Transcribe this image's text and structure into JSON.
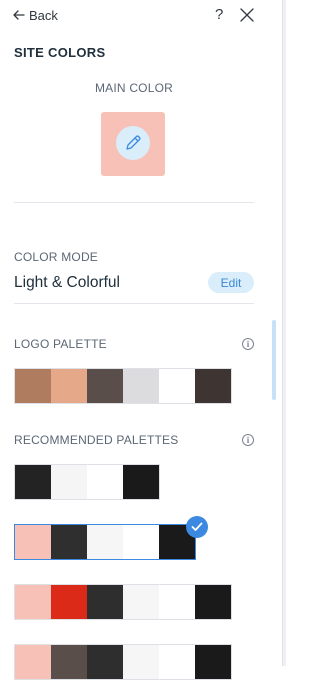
{
  "header": {
    "back_label": "Back",
    "help_label": "?"
  },
  "title": "SITE COLORS",
  "main_color": {
    "label": "MAIN COLOR",
    "color": "#f7c1b7"
  },
  "color_mode": {
    "label": "COLOR MODE",
    "value": "Light & Colorful",
    "edit_label": "Edit"
  },
  "logo_palette": {
    "label": "LOGO PALETTE",
    "info": "i",
    "colors": [
      "#b07c5f",
      "#e5a98a",
      "#5a4e4b",
      "#dcdcde",
      "#ffffff",
      "#3e3532"
    ]
  },
  "recommended": {
    "label": "RECOMMENDED PALETTES",
    "info": "i",
    "palettes": [
      {
        "colors": [
          "#232323",
          "#f5f5f5",
          "#ffffff",
          "#1a1a1a"
        ],
        "selected": false
      },
      {
        "colors": [
          "#f7c1b7",
          "#2f2f2f",
          "#f6f6f6",
          "#ffffff",
          "#1a1a1a"
        ],
        "selected": true
      },
      {
        "colors": [
          "#f7c1b7",
          "#db2a18",
          "#2e2e2e",
          "#f6f6f6",
          "#ffffff",
          "#1a1a1a"
        ],
        "selected": false
      },
      {
        "colors": [
          "#f7c1b7",
          "#5a4e4b",
          "#2e2e2e",
          "#f6f6f6",
          "#ffffff",
          "#1a1a1a"
        ],
        "selected": false
      }
    ]
  },
  "accent_color": "#3b89e0"
}
